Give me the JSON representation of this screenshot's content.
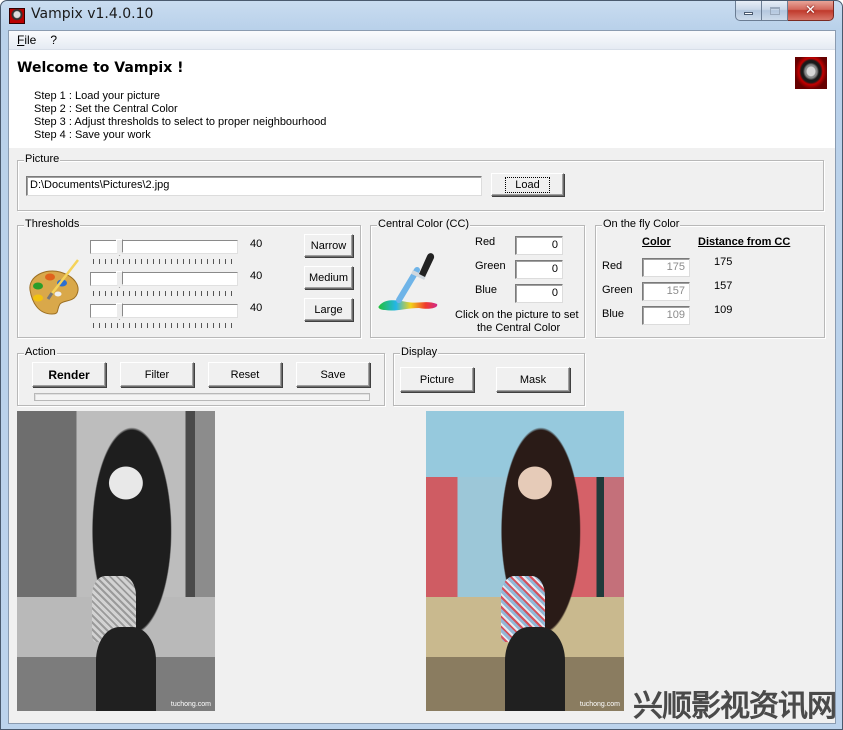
{
  "window": {
    "title": "Vampix v1.4.0.10",
    "controls": {
      "minimize": "minimize",
      "maximize": "maximize",
      "close": "✕"
    }
  },
  "menu": [
    {
      "label": "File",
      "accel": "F",
      "rest": "ile"
    },
    {
      "label": "?"
    }
  ],
  "welcome": {
    "title": "Welcome to Vampix !",
    "steps": [
      "Step 1 : Load your picture",
      "Step 2 : Set the Central Color",
      "Step 3 : Adjust thresholds to select to proper neighbourhood",
      "Step 4 : Save your work"
    ]
  },
  "picture": {
    "group_label": "Picture",
    "path_value": "D:\\Documents\\Pictures\\2.jpg",
    "load_label": "Load"
  },
  "thresholds": {
    "group_label": "Thresholds",
    "sliders": [
      {
        "value": 40,
        "max": 255
      },
      {
        "value": 40,
        "max": 255
      },
      {
        "value": 40,
        "max": 255
      }
    ],
    "value_labels": [
      "40",
      "40",
      "40"
    ],
    "buttons": [
      "Narrow",
      "Medium",
      "Large"
    ]
  },
  "central_color": {
    "group_label": "Central Color (CC)",
    "labels": [
      "Red",
      "Green",
      "Blue"
    ],
    "values": [
      "0",
      "0",
      "0"
    ],
    "hint_line1": "Click on the picture to set",
    "hint_line2": "the Central Color"
  },
  "on_the_fly": {
    "group_label": "On the fly Color",
    "col_color": "Color",
    "col_distance": "Distance from CC",
    "labels": [
      "Red",
      "Green",
      "Blue"
    ],
    "values": [
      "175",
      "157",
      "109"
    ],
    "distances": [
      "175",
      "157",
      "109"
    ]
  },
  "action": {
    "group_label": "Action",
    "buttons": [
      "Render",
      "Filter",
      "Reset",
      "Save"
    ],
    "progress": 0
  },
  "display": {
    "group_label": "Display",
    "buttons": [
      "Picture",
      "Mask"
    ]
  },
  "images": {
    "left_caption": "tuchong.com",
    "right_caption": "tuchong.com"
  },
  "watermark": "兴顺影视资讯网"
}
